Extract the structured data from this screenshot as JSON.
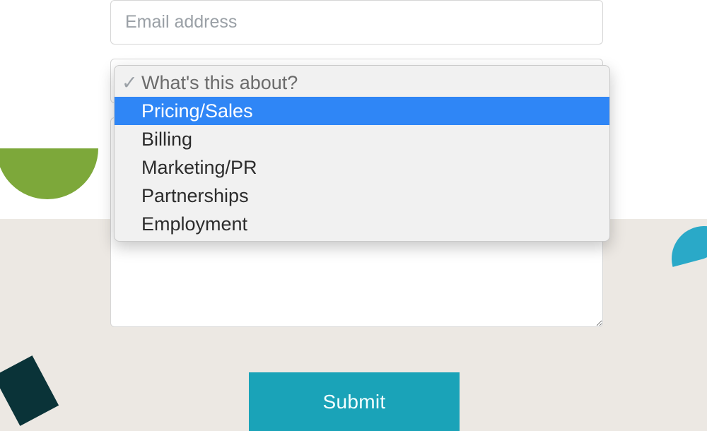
{
  "form": {
    "email": {
      "value": "",
      "placeholder": "Email address"
    },
    "subject": {
      "placeholder": "What's this about?",
      "selected": "",
      "highlighted_index": 0,
      "options": [
        "Pricing/Sales",
        "Billing",
        "Marketing/PR",
        "Partnerships",
        "Employment"
      ]
    },
    "message": {
      "value": "",
      "placeholder": ""
    },
    "submit_label": "Submit"
  },
  "icons": {
    "check": "✓"
  },
  "colors": {
    "accent_teal": "#1aa3b8",
    "highlight_blue": "#2f86f6",
    "deco_green": "#7da83a",
    "deco_dark": "#0a3338",
    "deco_teal": "#2aa9c8",
    "bg_lower": "#ece8e3"
  }
}
